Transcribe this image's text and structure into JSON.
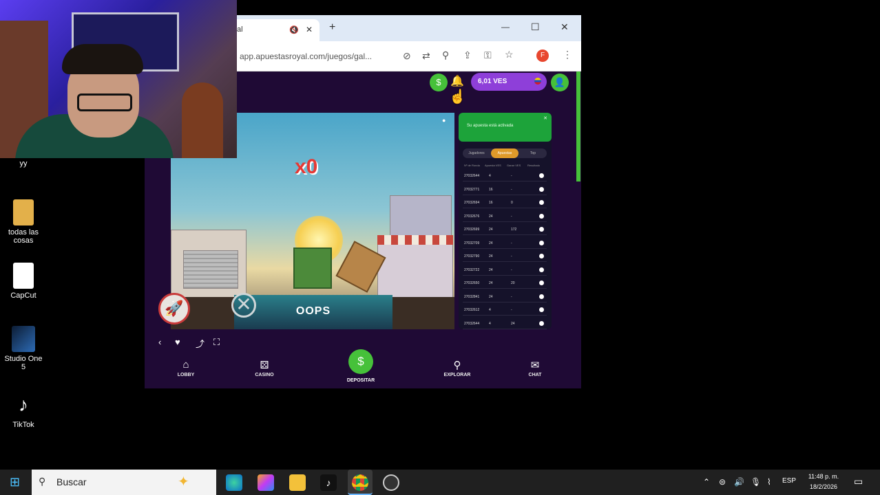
{
  "desktop": {
    "icons": [
      {
        "label": "yy",
        "color": "#3a8f3a"
      },
      {
        "label": "todas las cosas",
        "color": "#e3b04a"
      },
      {
        "label": "CapCut",
        "color": "#ffffff"
      },
      {
        "label": "Studio One 5",
        "color": "#1b3a6a"
      },
      {
        "label": "TikTok",
        "color": "#111111"
      }
    ]
  },
  "browser": {
    "tab_title": "al",
    "url": "app.apuestasroyal.com/juegos/gal...",
    "profile_initial": "F",
    "controls": {
      "minimize": "—",
      "maximize": "☐",
      "close": "✕",
      "new_tab": "+"
    }
  },
  "site": {
    "balance": "6,01 VES",
    "game": {
      "multiplier": "x0",
      "result": "OOPS"
    },
    "panel": {
      "notice": "Su apuesta está activada",
      "tabs": [
        "Jugadores",
        "Apuestas",
        "Top"
      ],
      "columns": [
        "Nº de Ronda",
        "Apuesta VES",
        "Ganar VES",
        "Resultado"
      ],
      "rows": [
        [
          "27032644",
          "4",
          "-"
        ],
        [
          "27032771",
          "16",
          "-"
        ],
        [
          "27032694",
          "16",
          "0"
        ],
        [
          "27032676",
          "24",
          "-"
        ],
        [
          "27032699",
          "24",
          "172"
        ],
        [
          "27032709",
          "24",
          "-"
        ],
        [
          "27032790",
          "24",
          "-"
        ],
        [
          "27032722",
          "24",
          "-"
        ],
        [
          "27032650",
          "24",
          "20"
        ],
        [
          "27032841",
          "24",
          "-"
        ],
        [
          "27032612",
          "4",
          "-"
        ],
        [
          "27032644",
          "4",
          "24"
        ]
      ]
    },
    "bottom_nav": [
      {
        "label": "LOBBY",
        "icon": "home-icon",
        "glyph": "⌂"
      },
      {
        "label": "CASINO",
        "icon": "dice-icon",
        "glyph": "⚄"
      },
      {
        "label": "DEPOSITAR",
        "icon": "deposit-icon",
        "glyph": "$"
      },
      {
        "label": "EXPLORAR",
        "icon": "search-icon",
        "glyph": "⚲"
      },
      {
        "label": "CHAT",
        "icon": "chat-icon",
        "glyph": "✉"
      }
    ]
  },
  "taskbar": {
    "search_placeholder": "Buscar",
    "language": "ESP",
    "time": "11:48 p. m.",
    "date": "18/2/2026"
  },
  "colors": {
    "site_bg": "#1f0a35",
    "accent_green": "#46c13a",
    "balance_purple": "#8e3fd9"
  }
}
